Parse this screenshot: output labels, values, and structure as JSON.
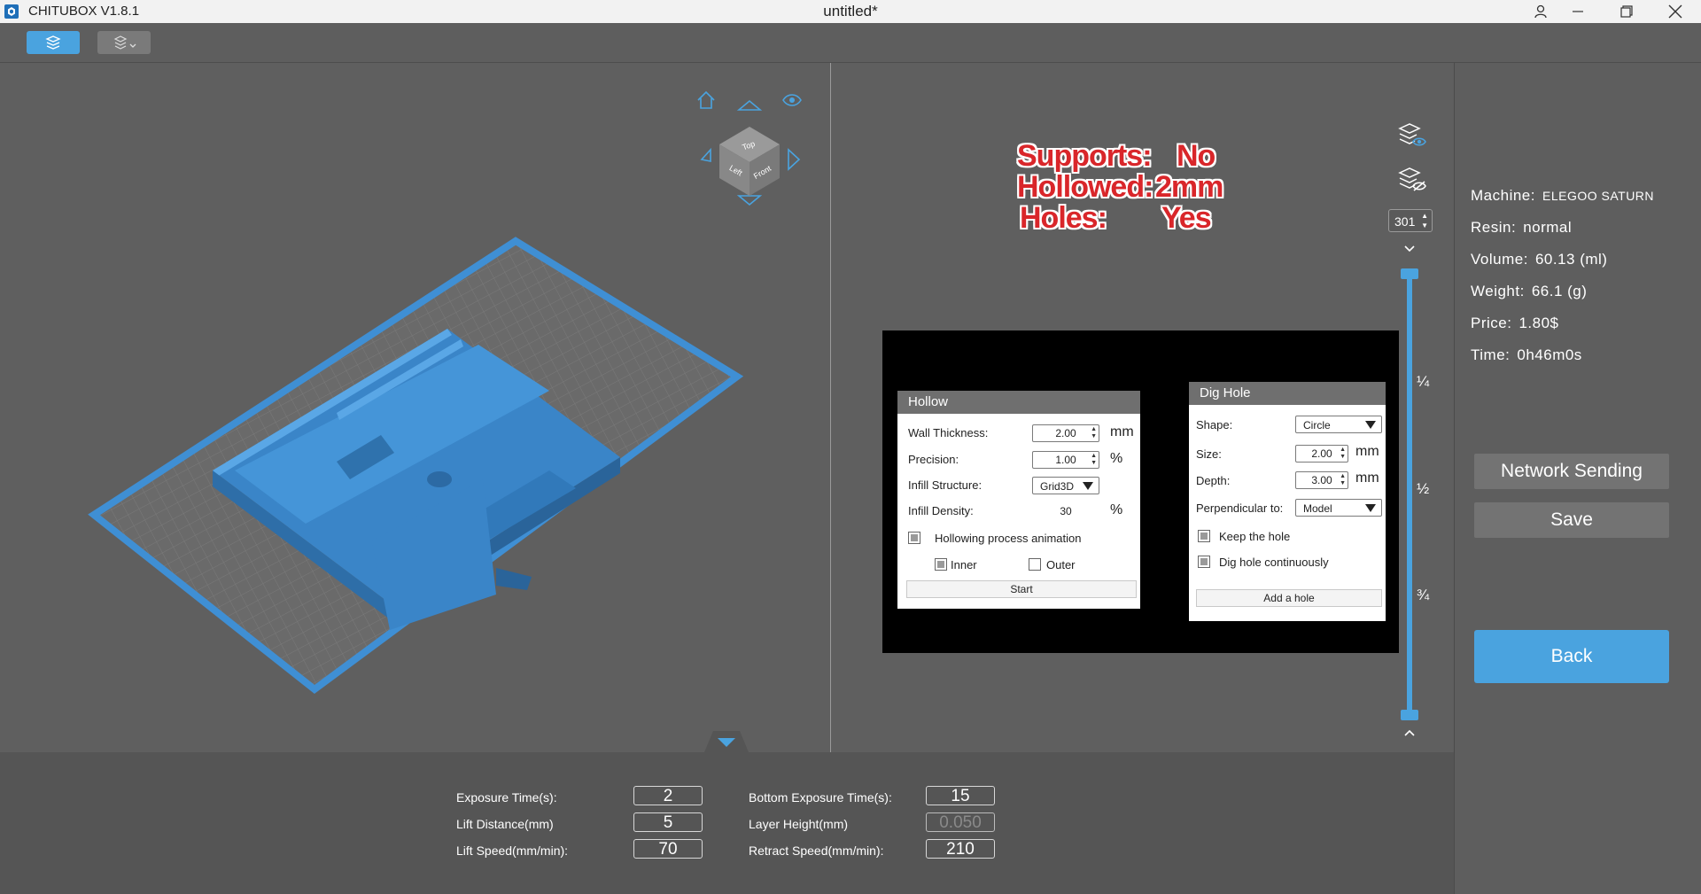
{
  "titlebar": {
    "app_name": "CHITUBOX V1.8.1",
    "document_title": "untitled*"
  },
  "overlay": {
    "supports_label": "Supports:",
    "supports_value": "No",
    "hollowed_label": "Hollowed:",
    "hollowed_value": "2mm",
    "holes_label": "Holes:",
    "holes_value": "Yes"
  },
  "hollow_dialog": {
    "title": "Hollow",
    "wall_thickness_label": "Wall Thickness:",
    "wall_thickness_value": "2.00",
    "wall_thickness_unit": "mm",
    "precision_label": "Precision:",
    "precision_value": "1.00",
    "precision_unit": "%",
    "infill_structure_label": "Infill Structure:",
    "infill_structure_value": "Grid3D",
    "infill_density_label": "Infill Density:",
    "infill_density_value": "30",
    "infill_density_unit": "%",
    "animation_label": "Hollowing process animation",
    "inner_label": "Inner",
    "outer_label": "Outer",
    "start_label": "Start"
  },
  "dig_hole_dialog": {
    "title": "Dig Hole",
    "shape_label": "Shape:",
    "shape_value": "Circle",
    "size_label": "Size:",
    "size_value": "2.00",
    "size_unit": "mm",
    "depth_label": "Depth:",
    "depth_value": "3.00",
    "depth_unit": "mm",
    "perpendicular_label": "Perpendicular to:",
    "perpendicular_value": "Model",
    "keep_hole_label": "Keep the hole",
    "continuous_label": "Dig hole continuously",
    "add_hole_label": "Add a hole"
  },
  "layer_slider": {
    "current_layer": "301",
    "tick_quarter": "¼",
    "tick_half": "½",
    "tick_three_quarter": "¾",
    "position_fraction": 1.0
  },
  "view_cube": {
    "top": "Top",
    "front": "Front",
    "left": "Left"
  },
  "info": {
    "machine_label": "Machine:",
    "machine_value": "ELEGOO SATURN",
    "resin_label": "Resin:",
    "resin_value": "normal",
    "volume_label": "Volume:",
    "volume_value": "60.13  (ml)",
    "weight_label": "Weight:",
    "weight_value": "66.1  (g)",
    "price_label": "Price:",
    "price_value": "1.80$",
    "time_label": "Time:",
    "time_value": "0h46m0s"
  },
  "buttons": {
    "network_sending": "Network Sending",
    "save": "Save",
    "back": "Back"
  },
  "params": {
    "exposure_label": "Exposure Time(s):",
    "exposure_value": "2",
    "lift_distance_label": "Lift Distance(mm)",
    "lift_distance_value": "5",
    "lift_speed_label": "Lift Speed(mm/min):",
    "lift_speed_value": "70",
    "bottom_exposure_label": "Bottom Exposure Time(s):",
    "bottom_exposure_value": "15",
    "layer_height_label": "Layer Height(mm)",
    "layer_height_value": "0.050",
    "retract_speed_label": "Retract Speed(mm/min):",
    "retract_speed_value": "210"
  },
  "colors": {
    "accent": "#4aa3df",
    "model": "#3f8fd4",
    "panel": "#5e5e5e",
    "overlay_red": "#d9262a"
  },
  "icons": [
    "app-logo-icon",
    "user-icon",
    "minimize-icon",
    "restore-icon",
    "close-icon",
    "slice-tool-icon",
    "layers-dropdown-icon",
    "home-view-icon",
    "eye-icon",
    "layers-show-icon",
    "layers-hide-icon",
    "chevron-down-icon",
    "chevron-up-icon"
  ]
}
